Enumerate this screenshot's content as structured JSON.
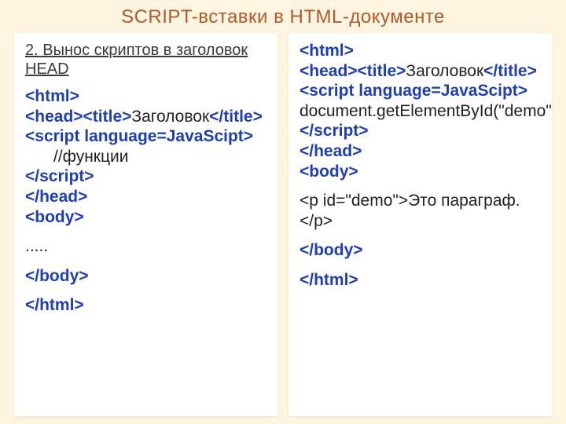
{
  "title": "SCRIPT-вставки в HTML-документе",
  "left": {
    "heading": "2. Вынос скриптов в заголовок HEAD",
    "l1": "<html>",
    "l2a": "<head><title>",
    "l2b": "Заголовок",
    "l2c": "</title>",
    "l3": "<script language=JavaScipt>",
    "l4": "//функции",
    "l5": "</script>",
    "l6": "</head>",
    "l7": "<body>",
    "l8": ".....",
    "l9": "</body>",
    "l10": "</html>"
  },
  "right": {
    "l1": "<html>",
    "l2a": "<head><title>",
    "l2b": "Заголовок",
    "l2c": "</title>",
    "l3": "<script language=JavaScipt>",
    "l4": "document.getElementById(\"demo\").innerHTML=Date();",
    "l5": "</script>",
    "l6": "</head>",
    "l7": "<body>",
    "l8": "<p id=\"demo\">Это параграф.</p>",
    "l9": "</body>",
    "l10": "</html>"
  }
}
